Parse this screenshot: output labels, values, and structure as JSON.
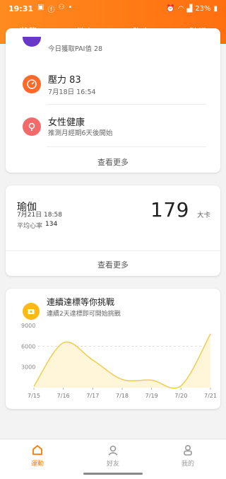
{
  "status_bar": {
    "time": "19:31",
    "battery": "23%"
  },
  "tabs": [
    "狀態",
    "健走",
    "跑步",
    "騎行"
  ],
  "card1": {
    "pai_partial": "今日獲取PAI值  28",
    "stress_title": "壓力 83",
    "stress_time": "7月18日 16:54",
    "women_title": "女性健康",
    "women_sub": "推測月經期6天後開始",
    "more": "查看更多"
  },
  "card2": {
    "title": "瑜伽",
    "date": "7月21日 18:58",
    "hr_label": "平均心率",
    "hr_value": "134",
    "calories": "179",
    "unit": "大卡",
    "more": "查看更多"
  },
  "challenge": {
    "title": "連續達標等你挑戰",
    "subtitle": "連續2天達標即可開始挑戰"
  },
  "chart_data": {
    "type": "line",
    "x": [
      "7/15",
      "7/16",
      "7/17",
      "7/18",
      "7/19",
      "7/20",
      "7/21"
    ],
    "values": [
      200,
      6500,
      4000,
      1200,
      1100,
      300,
      7800
    ],
    "y_ticks": [
      "9000",
      "6000",
      "3000"
    ],
    "ylim": [
      0,
      9000
    ],
    "goal_line": 6000,
    "line_color": "#f0cc50",
    "fill_color": "#fff6da"
  },
  "bottom_nav": [
    {
      "label": "運動"
    },
    {
      "label": "好友"
    },
    {
      "label": "我的"
    }
  ],
  "colors": {
    "brand": "#ff7a00",
    "stress": "#ff6a2a",
    "women": "#f36a6a",
    "medal": "#ffb914"
  }
}
